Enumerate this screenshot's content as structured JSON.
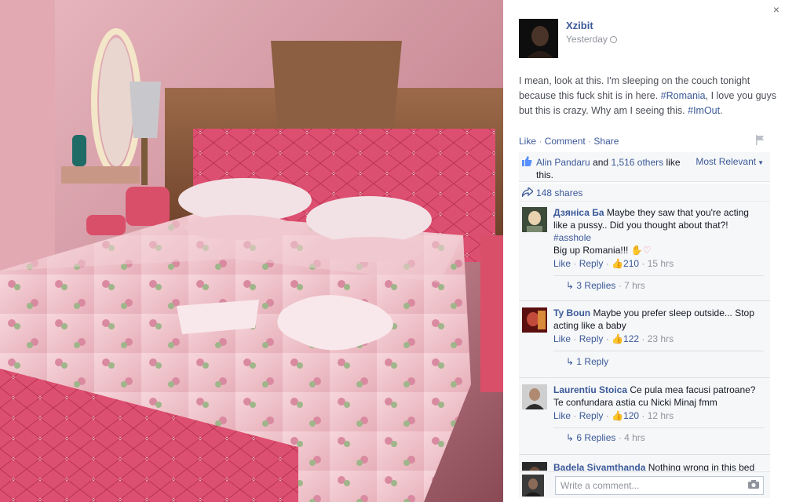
{
  "close_label": "×",
  "post": {
    "author": "Xzibit",
    "time": "Yesterday",
    "text_parts": [
      "I mean, look at this. I'm sleeping on the couch tonight because this fuck shit is in here. ",
      "#Romania",
      ", I love you guys but this is crazy. Why am I seeing this. ",
      "#ImOut",
      "."
    ],
    "actions": {
      "like": "Like",
      "comment": "Comment",
      "share": "Share",
      "separator": "·"
    }
  },
  "likes": {
    "first_name": "Alin Pandaru",
    "and": "and",
    "others": "1,516 others",
    "suffix": "like this.",
    "sort_label": "Most Relevant"
  },
  "shares": {
    "label": "148 shares"
  },
  "comments": [
    {
      "author": "Дзяніса Ба",
      "text": "Maybe they saw that you're acting like a pussy.. Did you thought about that?!",
      "hashtag": "#asshole",
      "extra": "Big up Romania!!!",
      "like": "Like",
      "reply": "Reply",
      "likes": "210",
      "age": "15 hrs",
      "replies": "3 Replies",
      "replies_age": "7 hrs"
    },
    {
      "author": "Ty Boun",
      "text": "Maybe you prefer sleep outside... Stop acting like a baby",
      "like": "Like",
      "reply": "Reply",
      "likes": "122",
      "age": "23 hrs",
      "replies": "1 Reply"
    },
    {
      "author": "Laurentiu Stoica",
      "text": "Ce pula mea facusi patroane? Te confundara astia cu Nicki Minaj fmm",
      "like": "Like",
      "reply": "Reply",
      "likes": "120",
      "age": "12 hrs",
      "replies": "6 Replies",
      "replies_age": "4 hrs"
    },
    {
      "author": "Badela Siyamthanda",
      "text": "Nothing wrong in this bed"
    }
  ],
  "composer": {
    "placeholder": "Write a comment..."
  },
  "colors": {
    "link": "#3b5998",
    "muted": "#90949c",
    "headboard": "#d9456a"
  }
}
